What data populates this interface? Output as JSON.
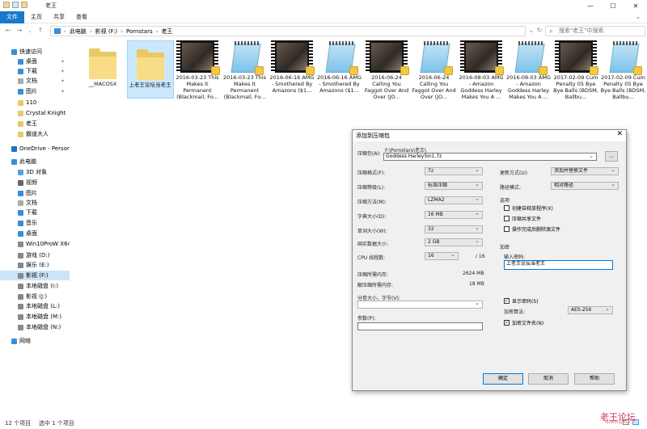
{
  "window": {
    "title": "老王",
    "controls": {
      "minimize": "—",
      "maximize": "☐",
      "close": "✕"
    }
  },
  "ribbon": {
    "tabs": [
      "文件",
      "主页",
      "共享",
      "查看"
    ]
  },
  "address": {
    "crumbs": [
      "此电脑",
      "影视 (F:)",
      "Pornstars",
      "老王"
    ],
    "search_placeholder": "搜索\"老王\"中搜索"
  },
  "sidebar": {
    "items": [
      {
        "label": "快速访问",
        "color": "#3b8fd9"
      },
      {
        "label": "桌面",
        "color": "#3b8fd9",
        "pinned": true
      },
      {
        "label": "下载",
        "color": "#3b8fd9",
        "pinned": true
      },
      {
        "label": "文档",
        "color": "#aaa",
        "pinned": true
      },
      {
        "label": "图片",
        "color": "#3b8fd9",
        "pinned": true
      },
      {
        "label": "110",
        "color": "#e9c866"
      },
      {
        "label": "Crystal Knight",
        "color": "#e9c866"
      },
      {
        "label": "老王",
        "color": "#e9c866"
      },
      {
        "label": "霸道大人",
        "color": "#e9c866"
      },
      {
        "label": "OneDrive - Persona",
        "color": "#1a73c8"
      },
      {
        "label": "此电脑",
        "color": "#3b8fd9"
      },
      {
        "label": "3D 对象",
        "color": "#5aa0d8"
      },
      {
        "label": "视频",
        "color": "#666"
      },
      {
        "label": "图片",
        "color": "#3b8fd9"
      },
      {
        "label": "文档",
        "color": "#aaa"
      },
      {
        "label": "下载",
        "color": "#3b8fd9"
      },
      {
        "label": "音乐",
        "color": "#3b8fd9"
      },
      {
        "label": "桌面",
        "color": "#3b8fd9"
      },
      {
        "label": "Win10ProW X64 (C",
        "color": "#888"
      },
      {
        "label": "游戏 (D:)",
        "color": "#888"
      },
      {
        "label": "娱乐 (E:)",
        "color": "#888"
      },
      {
        "label": "影视 (F:)",
        "color": "#888",
        "selected": true
      },
      {
        "label": "本地磁盘 (I:)",
        "color": "#888"
      },
      {
        "label": "影视 (J:)",
        "color": "#888"
      },
      {
        "label": "本地磁盘 (L:)",
        "color": "#888"
      },
      {
        "label": "本地磁盘 (M:)",
        "color": "#888"
      },
      {
        "label": "本地磁盘 (N:)",
        "color": "#888"
      },
      {
        "label": "网络",
        "color": "#3b8fd9"
      }
    ]
  },
  "files": [
    {
      "type": "folder",
      "name": "__MACOSX"
    },
    {
      "type": "folder",
      "name": "上老王论坛当老王",
      "selected": true
    },
    {
      "type": "video",
      "name": "2016-03-23 This Makes It Permanent (Blackmail, Fo..."
    },
    {
      "type": "text",
      "name": "2016-03-23 This Makes It Permanent (Blackmail, Fo..."
    },
    {
      "type": "video",
      "name": "2016-06-16 AMG - Smothered By Amazons ($1..."
    },
    {
      "type": "text",
      "name": "2016-06-16 AMG - Smothered By Amazons ($1..."
    },
    {
      "type": "video",
      "name": "2016-06-24 Calling You Faggot Over And Over (JO..."
    },
    {
      "type": "text",
      "name": "2016-06-24 Calling You Faggot Over And Over (JO..."
    },
    {
      "type": "video",
      "name": "2016-08-03 AMG - Amazon Goddess Harley Makes You A ..."
    },
    {
      "type": "text",
      "name": "2016-08-03 AMG - Amazon Goddess Harley Makes You A ..."
    },
    {
      "type": "video",
      "name": "2017-02-09 Cum Penalty 05 Bye Bye Balls (BDSM, Ballbu..."
    },
    {
      "type": "text",
      "name": "2017-02-09 Cum Penalty 05 Bye Bye Balls (BDSM, Ballbu..."
    }
  ],
  "status": {
    "count": "12 个项目",
    "selected": "选中 1 个项目"
  },
  "dialog": {
    "title": "添加到压缩包",
    "close": "✕",
    "archive_label": "压缩包(A):",
    "archive_path": "F:\\Pornstars\\老王\\",
    "archive_name": "Goddess Harley5in1.7z",
    "browse": "...",
    "format_label": "压缩格式(F):",
    "format_value": "7z",
    "level_label": "压缩等级(L):",
    "level_value": "标准压缩",
    "method_label": "压缩方法(M):",
    "method_value": "LZMA2",
    "dict_label": "字典大小(D):",
    "dict_value": "16 MB",
    "word_label": "单词大小(W):",
    "word_value": "32",
    "solid_label": "固实数据大小:",
    "solid_value": "2 GB",
    "cpu_label": "CPU 线程数:",
    "cpu_value": "16",
    "cpu_total": "/ 16",
    "mem_comp_label": "压缩所需内存:",
    "mem_comp_value": "2624 MB",
    "mem_decomp_label": "解压缩所需内存:",
    "mem_decomp_value": "18 MB",
    "split_label": "分卷大小，字节(V):",
    "params_label": "参数(P):",
    "update_label": "更新方式(U):",
    "update_value": "添加并替换文件",
    "pathmode_label": "路径模式:",
    "pathmode_value": "相对路径",
    "options_title": "选项",
    "opt_sfx": "创建自释放程序(X)",
    "opt_shared": "压缩共享文件",
    "opt_delete": "操作完成后删除源文件",
    "enc_title": "加密",
    "pwd_label": "输入密码:",
    "pwd_value": "上老王论坛当老王",
    "show_pwd": "显示密码(S)",
    "enc_method_label": "加密算法:",
    "enc_method_value": "AES-256",
    "enc_names": "加密文件名(N)",
    "ok": "确定",
    "cancel": "取消",
    "help": "帮助"
  },
  "watermark": {
    "text": "老王论坛",
    "sub": "laowang.vip"
  }
}
